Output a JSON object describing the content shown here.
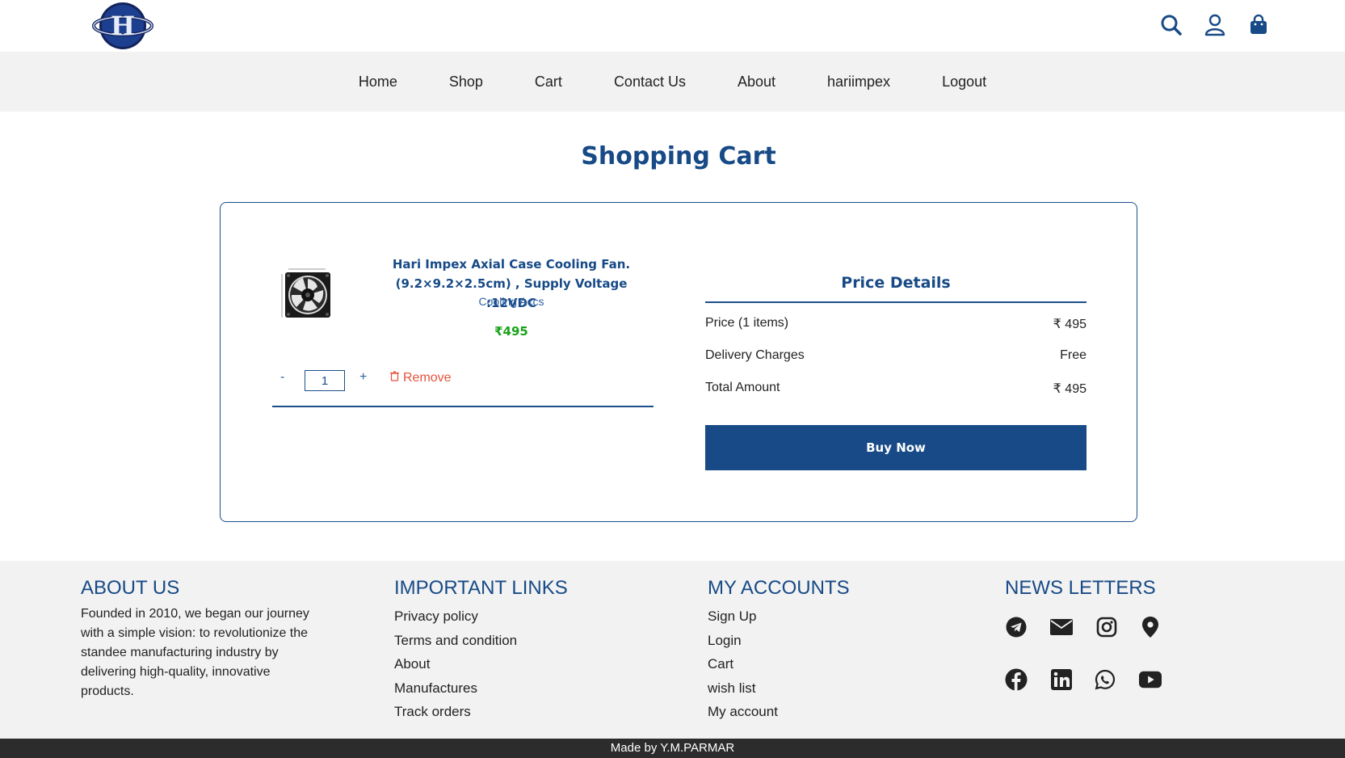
{
  "header": {
    "icons": [
      "search-icon",
      "user-icon",
      "shopping-bag-icon"
    ]
  },
  "nav": {
    "items": [
      "Home",
      "Shop",
      "Cart",
      "Contact Us",
      "About",
      "hariimpex",
      "Logout"
    ]
  },
  "page": {
    "title": "Shopping Cart"
  },
  "cart": {
    "item": {
      "name": "Hari Impex Axial Case Cooling Fan. (9.2×9.2×2.5cm) , Supply Voltage :12VDC",
      "category": "Cooling Accs",
      "price": "₹495",
      "quantity": "1",
      "minus_label": "-",
      "plus_label": "+",
      "remove_label": "Remove"
    },
    "price_details": {
      "title": "Price Details",
      "rows": [
        {
          "label": "Price (1 items)",
          "value": "₹ 495"
        },
        {
          "label": "Delivery Charges",
          "value": "Free"
        },
        {
          "label": "Total Amount",
          "value": "₹ 495"
        }
      ],
      "buy_label": "Buy Now"
    }
  },
  "footer": {
    "about": {
      "heading": "ABOUT US",
      "text": "Founded in 2010, we began our journey with a simple vision: to revolutionize the standee manufacturing industry by delivering high-quality, innovative products."
    },
    "links": {
      "heading": "IMPORTANT LINKS",
      "items": [
        "Privacy policy",
        "Terms and condition",
        "About",
        "Manufactures",
        "Track orders"
      ]
    },
    "accounts": {
      "heading": "MY ACCOUNTS",
      "items": [
        "Sign Up",
        "Login",
        "Cart",
        "wish list",
        "My account"
      ]
    },
    "news": {
      "heading": "NEWS LETTERS",
      "icons": [
        "telegram-icon",
        "email-icon",
        "instagram-icon",
        "location-pin-icon",
        "facebook-icon",
        "linkedin-icon",
        "whatsapp-icon",
        "youtube-icon"
      ]
    },
    "credit": "Made by Y.M.PARMAR"
  },
  "colors": {
    "brand": "#174a86",
    "price_green": "#1aa31a",
    "remove_red": "#e5533d",
    "nav_bg": "#f2f2f2",
    "bottom_bar": "#2c2c2c"
  }
}
